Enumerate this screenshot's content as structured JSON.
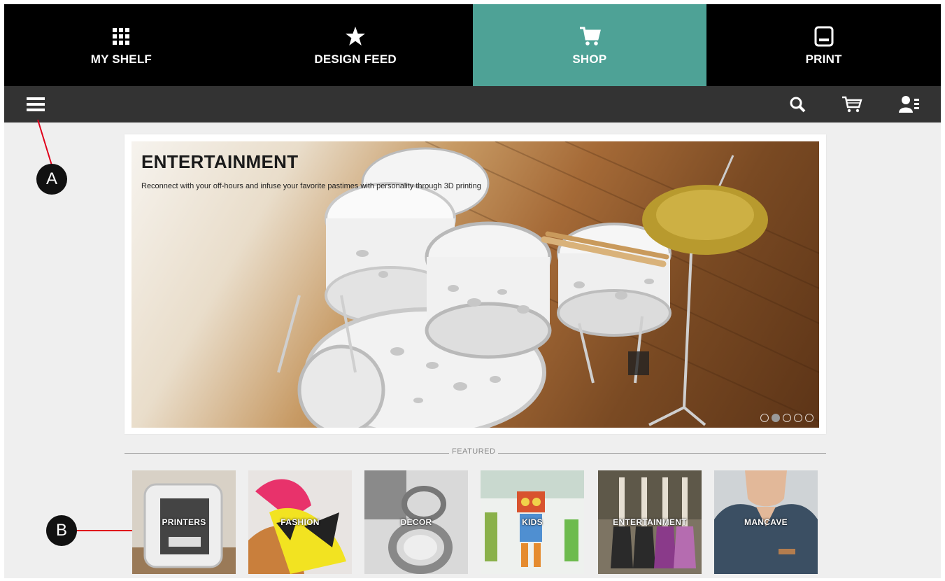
{
  "nav": {
    "tabs": [
      {
        "label": "MY SHELF",
        "icon": "grid-icon"
      },
      {
        "label": "DESIGN FEED",
        "icon": "star-icon"
      },
      {
        "label": "SHOP",
        "icon": "cart-icon",
        "active": true
      },
      {
        "label": "PRINT",
        "icon": "printer-icon"
      }
    ]
  },
  "colors": {
    "active_tab": "#4ea296",
    "nav_bg": "#000000",
    "toolbar_bg": "#333333",
    "page_bg": "#efefef",
    "callout_line": "#e0001b"
  },
  "toolbar": {
    "icons": [
      "menu-icon",
      "search-icon",
      "cart-icon",
      "account-icon"
    ]
  },
  "hero": {
    "title": "ENTERTAINMENT",
    "subtitle": "Reconnect with your off-hours and infuse your favorite pastimes with personality through 3D printing",
    "slide_count": 5,
    "active_slide": 2
  },
  "featured": {
    "label": "FEATURED",
    "tiles": [
      {
        "label": "PRINTERS"
      },
      {
        "label": "FASHION"
      },
      {
        "label": "DECOR"
      },
      {
        "label": "KIDS"
      },
      {
        "label": "ENTERTAINMENT"
      },
      {
        "label": "MANCAVE"
      }
    ]
  },
  "callouts": {
    "a": "A",
    "b": "B"
  }
}
